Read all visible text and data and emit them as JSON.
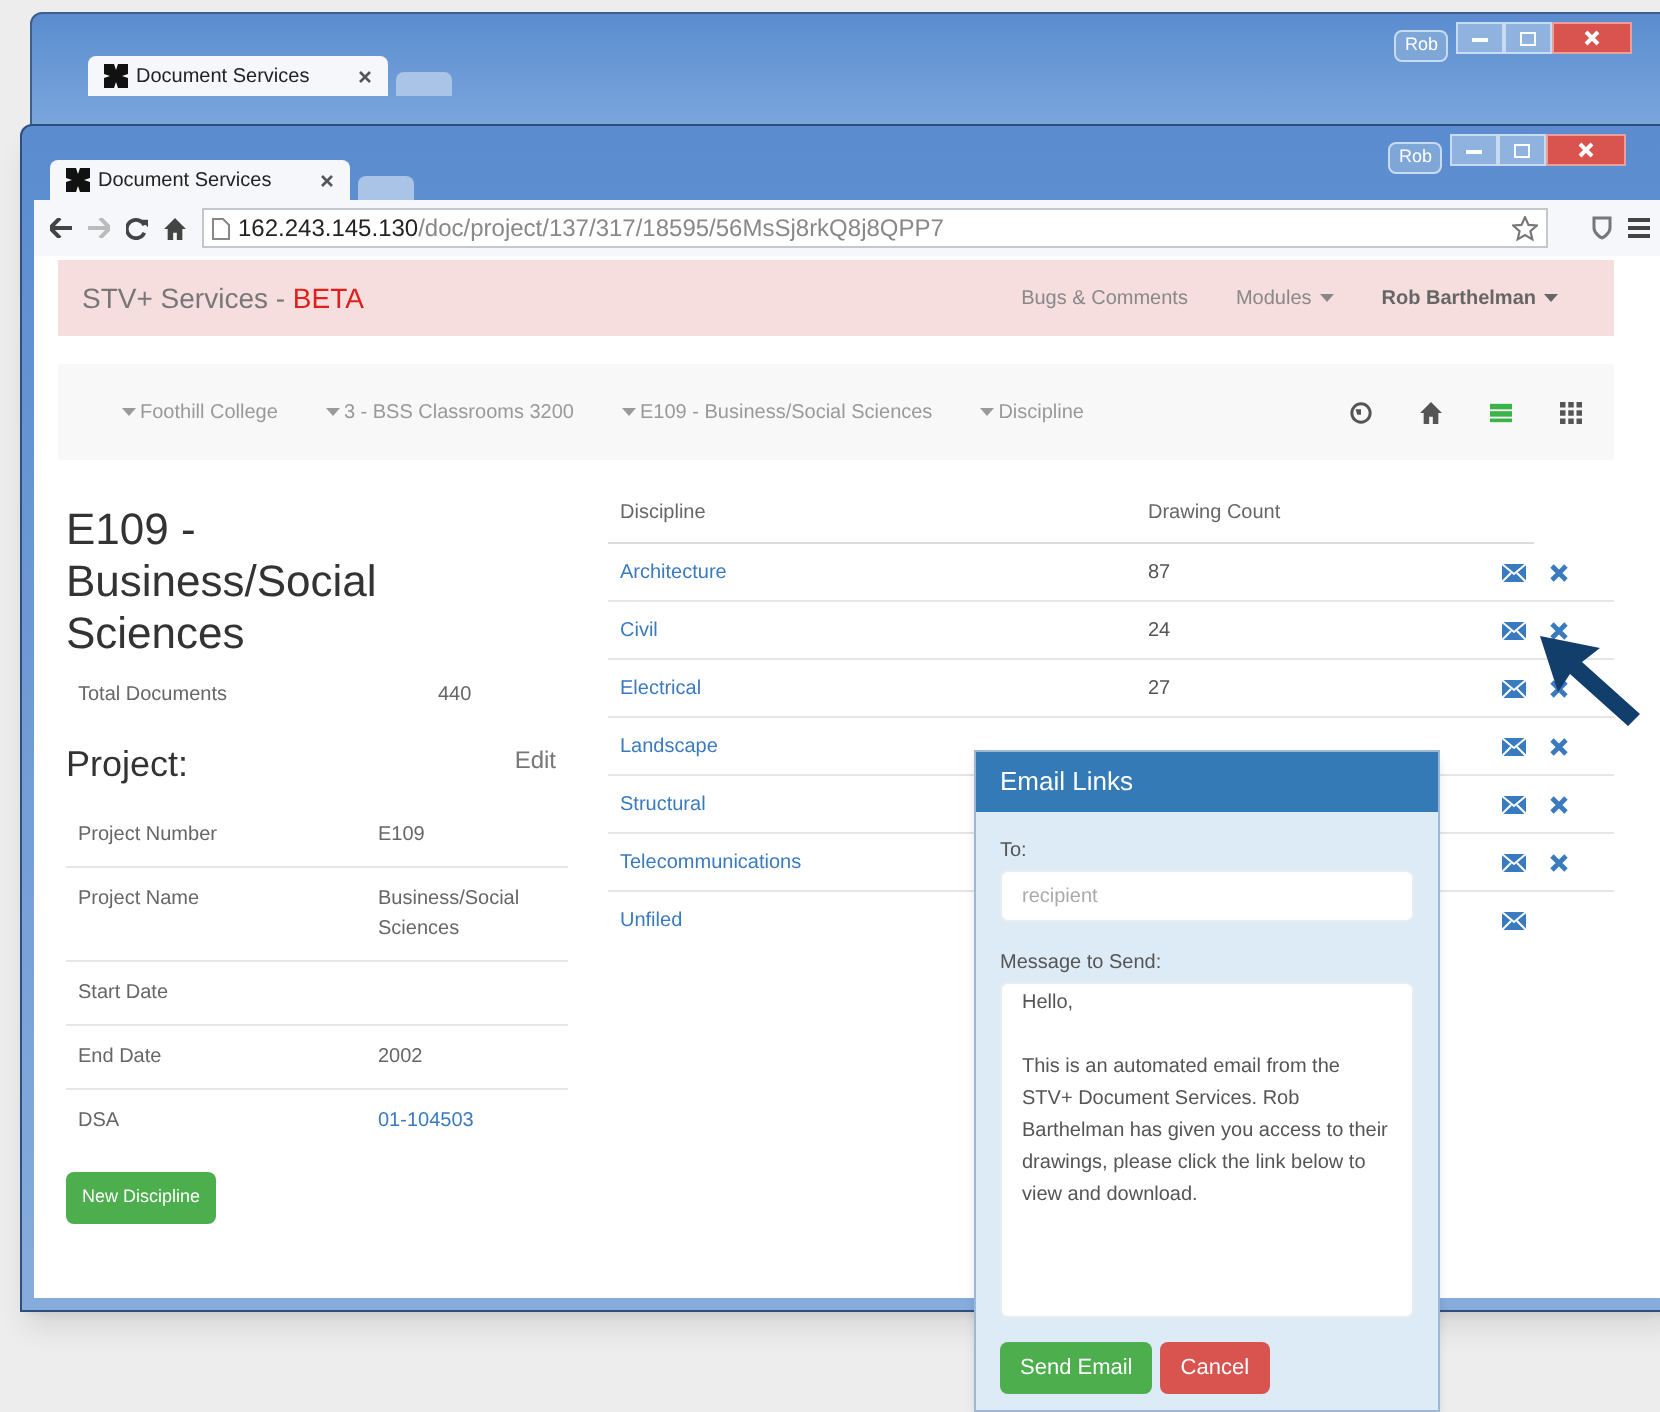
{
  "back_window": {
    "tab_title": "Document Services",
    "profile": "Rob"
  },
  "browser": {
    "tab_title": "Document Services",
    "url_host": "162.243.145.130",
    "url_path": "/doc/project/137/317/18595/56MsSj8rkQ8j8QPP7",
    "profile": "Rob"
  },
  "navbar": {
    "brand": "STV+ Services - ",
    "brand_badge": "BETA",
    "links": [
      {
        "label": "Bugs & Comments",
        "dropdown": false
      },
      {
        "label": "Modules",
        "dropdown": true
      }
    ],
    "user": "Rob Barthelman"
  },
  "breadcrumb": [
    "Foothill College",
    "3 - BSS Classrooms 3200",
    "E109 - Business/Social Sciences",
    "Discipline"
  ],
  "view_buttons": [
    {
      "kind": "globe",
      "selected": false
    },
    {
      "kind": "home",
      "selected": false
    },
    {
      "kind": "list",
      "selected": true
    },
    {
      "kind": "grid",
      "selected": false
    }
  ],
  "heading": "E109 - Business/Social Sciences",
  "total": {
    "label": "Total Documents",
    "value": "440"
  },
  "project": {
    "title": "Project:",
    "edit": "Edit",
    "rows": [
      {
        "label": "Project Number",
        "value": "E109",
        "link": false
      },
      {
        "label": "Project Name",
        "value": "Business/Social Sciences",
        "link": false
      },
      {
        "label": "Start Date"
      },
      {
        "label": "End Date",
        "value": "2002",
        "link": false
      },
      {
        "label": "DSA",
        "value": "01-104503",
        "link": true
      }
    ]
  },
  "new_button": "New Discipline",
  "table": {
    "columns": [
      "Discipline",
      "Drawing Count"
    ],
    "rows": [
      {
        "name": "Architecture",
        "count": "87",
        "deletable": true
      },
      {
        "name": "Civil",
        "count": "24",
        "deletable": true
      },
      {
        "name": "Electrical",
        "count": "27",
        "deletable": true
      },
      {
        "name": "Landscape",
        "deletable": true
      },
      {
        "name": "Structural",
        "deletable": true
      },
      {
        "name": "Telecommunications",
        "deletable": true
      },
      {
        "name": "Unfiled",
        "deletable": false
      }
    ]
  },
  "dialog": {
    "title": "Email Links",
    "to_label": "To:",
    "to_placeholder": "recipient",
    "message_label": "Message to Send:",
    "message": "Hello,\n\nThis is an automated email from the STV+ Document Services. Rob Barthelman has given you access to their drawings, please click the link below to view and download.",
    "send": "Send Email",
    "cancel": "Cancel"
  }
}
